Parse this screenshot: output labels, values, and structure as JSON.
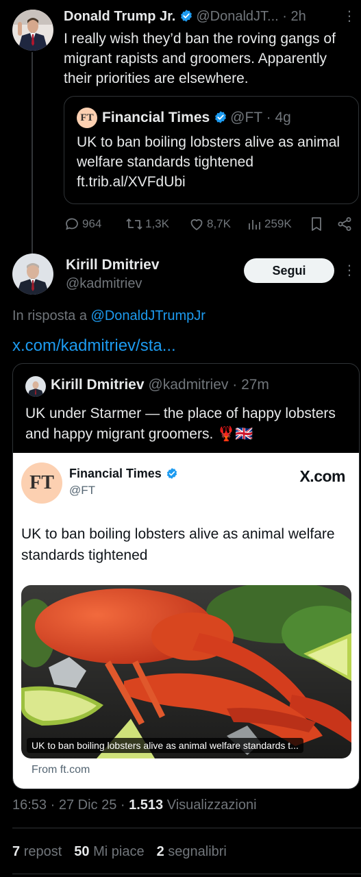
{
  "tweet1": {
    "author_name": "Donald Trump Jr.",
    "author_handle": "@DonaldJT...",
    "time": "2h",
    "text": "I really wish they’d ban the roving gangs of migrant rapists and groomers. Apparently their priorities are elsewhere.",
    "quote": {
      "avatar_text": "FT",
      "author_name": "Financial Times",
      "author_handle": "@FT",
      "time": "4g",
      "text": "UK to ban boiling lobsters alive as animal welfare standards tightened ft.trib.al/XVFdUbi"
    },
    "actions": {
      "replies": "964",
      "reposts": "1,3K",
      "likes": "8,7K",
      "views": "259K"
    }
  },
  "tweet2": {
    "author_name": "Kirill Dmitriev",
    "author_handle": "@kadmitriev",
    "follow_label": "Segui",
    "reply_prefix": "In risposta a",
    "reply_to": "@DonaldJTrumpJr",
    "link": "x.com/kadmitriev/sta...",
    "quote": {
      "author_name": "Kirill Dmitriev",
      "author_handle": "@kadmitriev",
      "time": "27m",
      "text": "UK under Starmer — the place of happy lobsters and happy migrant groomers. 🦞🇬🇧",
      "card": {
        "avatar_text": "FT",
        "name": "Financial Times",
        "handle": "@FT",
        "site": "X.com",
        "title": "UK to ban boiling lobsters alive as animal welfare standards tightened",
        "image_caption": "UK to ban boiling lobsters alive as animal welfare standards t...",
        "from": "From ft.com"
      }
    },
    "time": "16:53",
    "date": "27 Dic 25",
    "views_count": "1.513",
    "views_label": "Visualizzazioni",
    "reposts_count": "7",
    "reposts_label": "repost",
    "likes_count": "50",
    "likes_label": "Mi piace",
    "bookmarks_count": "2",
    "bookmarks_label": "segnalibri"
  },
  "colors": {
    "background": "#000000",
    "text": "#e7e9ea",
    "muted": "#71767b",
    "link": "#1d9bf0",
    "verified": "#1d9bf0",
    "ft_pink": "#fcd0b1",
    "border": "#2f3336"
  }
}
